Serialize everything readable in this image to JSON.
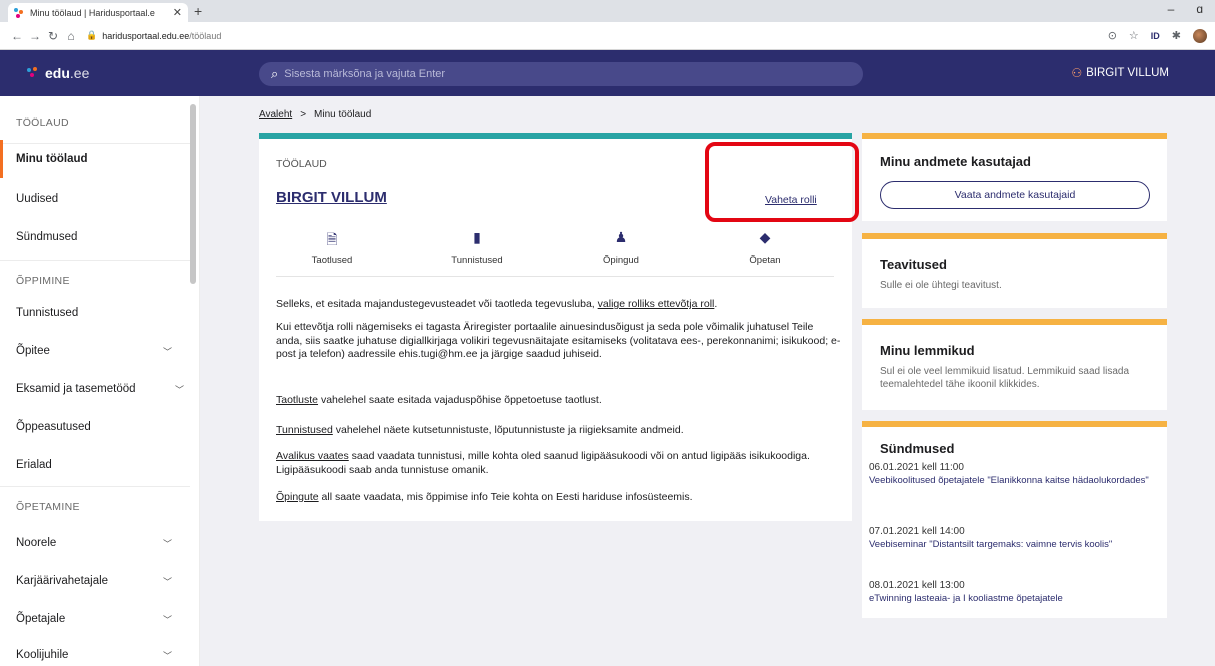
{
  "browser": {
    "tab_title": "Minu töölaud | Haridusportaal.e",
    "close": "✕",
    "newtab": "+",
    "host": "haridusportaal.edu.ee",
    "path": "/töölaud",
    "window_min": "–",
    "window_max": "ɑ"
  },
  "site": {
    "logo_main": "edu",
    "logo_suffix": ".ee",
    "search_placeholder": "Sisesta märksõna ja vajuta Enter",
    "user_name": "BIRGIT VILLUM"
  },
  "sidebar": {
    "items": [
      {
        "label": "TÖÖLAUD"
      },
      {
        "label": "Minu töölaud"
      },
      {
        "label": "Uudised"
      },
      {
        "label": "Sündmused"
      },
      {
        "label": "ÕPPIMINE"
      },
      {
        "label": "Tunnistused"
      },
      {
        "label": "Õpitee"
      },
      {
        "label": "Eksamid ja tasemetööd"
      },
      {
        "label": "Õppeasutused"
      },
      {
        "label": "Erialad"
      },
      {
        "label": "ÕPETAMINE"
      },
      {
        "label": "Noorele"
      },
      {
        "label": "Karjäärivahetajale"
      },
      {
        "label": "Õpetajale"
      },
      {
        "label": "Koolijuhile"
      }
    ]
  },
  "breadcrumb": {
    "home": "Avaleht",
    "sep": ">",
    "current": "Minu töölaud"
  },
  "main": {
    "label": "TÖÖLAUD",
    "name": "BIRGIT VILLUM",
    "change_role": "Vaheta rolli",
    "tabs": [
      {
        "label": "Taotlused",
        "icon": "document-icon"
      },
      {
        "label": "Tunnistused",
        "icon": "book-icon"
      },
      {
        "label": "Õpingud",
        "icon": "student-icon"
      },
      {
        "label": "Õpetan",
        "icon": "graduation-cap-icon"
      }
    ],
    "p1": "Selleks, et esitada majandustegevusteadet või taotleda tegevusluba, ",
    "p1_link": "valige rolliks ettevõtja roll",
    "p1_end": ".",
    "p2": "Kui ettevõtja rolli nägemiseks ei tagasta Äriregister portaalile ainuesindusõigust ja seda pole võimalik juhatusel Teile anda, siis saatke juhatuse digiallkirjaga volikiri tegevusnäitajate esitamiseks (volitatava ees-, perekonnanimi; isikukood; e-post ja telefon) aadressile ehis.tugi@hm.ee ja järgige saadud juhiseid.",
    "p3_link": "Taotluste",
    "p3": " vahelehel saate esitada vajaduspõhise õppetoetuse taotlust.",
    "p4_link": "Tunnistused",
    "p4": " vahelehel näete kutsetunnistuste, lõputunnistuste ja riigieksamite andmeid.",
    "p5_link": "Avalikus vaates",
    "p5": " saad vaadata tunnistusi, mille kohta oled saanud ligipääsukoodi või on antud ligipääs isikukoodiga. Ligipääsukoodi saab anda tunnistuse omanik.",
    "p6_link": "Õpingute",
    "p6": " all saate vaadata, mis õppimise info Teie kohta on Eesti hariduse infosüsteemis."
  },
  "right": {
    "data_users_title": "Minu andmete kasutajad",
    "data_users_btn": "Vaata andmete kasutajaid",
    "notif_title": "Teavitused",
    "notif_text": "Sulle ei ole ühtegi teavitust.",
    "fav_title": "Minu lemmikud",
    "fav_text": "Sul ei ole veel lemmikuid lisatud. Lemmikuid saad lisada teemalehtedel tähe ikoonil klikkides.",
    "events_title": "Sündmused",
    "events": [
      {
        "date": "06.01.2021 kell 11:00",
        "title": "Veebikoolitused õpetajatele \"Elanikkonna kaitse hädaolukordades\""
      },
      {
        "date": "07.01.2021 kell 14:00",
        "title": "Veebiseminar \"Distantsilt targemaks: vaimne tervis koolis\""
      },
      {
        "date": "08.01.2021 kell 13:00",
        "title": "eTwinning lasteaia- ja I kooliastme õpetajatele"
      }
    ]
  },
  "colors": {
    "header": "#2c2d6e",
    "teal": "#28a4a4",
    "orange": "#f6b243",
    "highlight": "#e30613",
    "active": "#f36f21"
  }
}
